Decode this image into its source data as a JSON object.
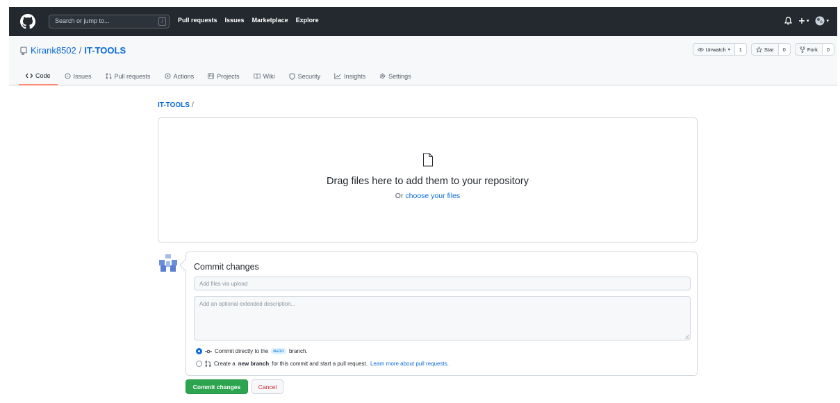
{
  "header": {
    "search_placeholder": "Search or jump to...",
    "search_key": "/",
    "nav": [
      "Pull requests",
      "Issues",
      "Marketplace",
      "Explore"
    ],
    "icons": [
      "github-logo",
      "bell-icon",
      "plus-icon",
      "avatar-icon"
    ]
  },
  "repo": {
    "owner": "Kirank8502",
    "separator": "/",
    "name": "IT-TOOLS",
    "watch": {
      "label": "Unwatch",
      "count": "1"
    },
    "star": {
      "label": "Star",
      "count": "0"
    },
    "fork": {
      "label": "Fork",
      "count": "0"
    },
    "tabs": [
      "Code",
      "Issues",
      "Pull requests",
      "Actions",
      "Projects",
      "Wiki",
      "Security",
      "Insights",
      "Settings"
    ],
    "active_tab": "Code"
  },
  "breadcrumb": {
    "repo": "IT-TOOLS",
    "separator": "/"
  },
  "dropzone": {
    "title": "Drag files here to add them to your repository",
    "sub_prefix": "Or",
    "sub_link": "choose your files"
  },
  "commit": {
    "title": "Commit changes",
    "summary_placeholder": "Add files via upload",
    "description_placeholder": "Add an optional extended description...",
    "option_direct": {
      "prefix": "Commit directly to the",
      "branch": "main",
      "suffix": "branch.",
      "selected": true
    },
    "option_new": {
      "prefix": "Create a",
      "bold": "new branch",
      "middle": "for this commit and start a pull request.",
      "link": "Learn more about pull requests.",
      "selected": false
    },
    "submit_label": "Commit changes",
    "cancel_label": "Cancel"
  },
  "colors": {
    "header_bg": "#24292f",
    "link": "#0969da",
    "primary_button": "#2da44e",
    "cancel_text": "#cf222e",
    "tab_underline": "#fd8c73"
  }
}
